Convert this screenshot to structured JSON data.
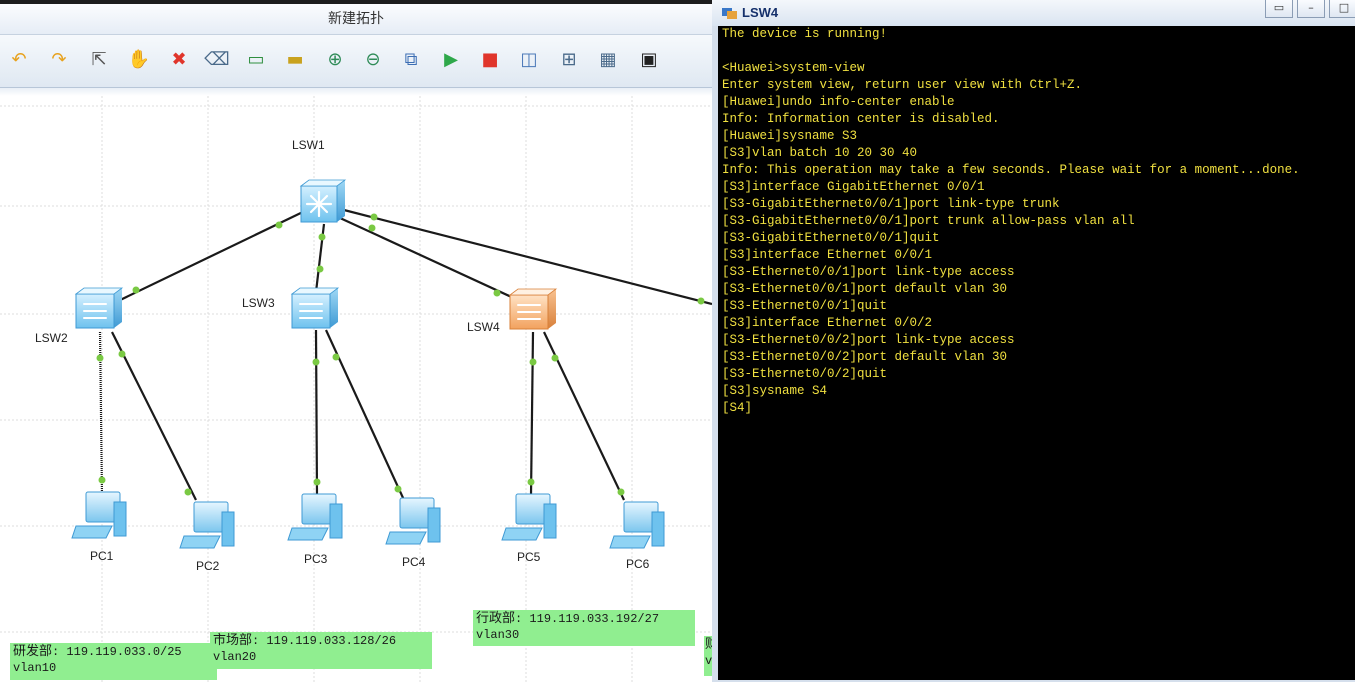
{
  "ensp": {
    "title": "新建拓扑",
    "toolbar": [
      {
        "name": "undo-icon",
        "glyph": "↶"
      },
      {
        "name": "redo-icon",
        "glyph": "↷"
      },
      {
        "name": "select-pointer-icon",
        "glyph": "⇱"
      },
      {
        "name": "pan-hand-icon",
        "glyph": "✋"
      },
      {
        "name": "delete-icon",
        "glyph": "✖"
      },
      {
        "name": "delete-link-icon",
        "glyph": "⌫"
      },
      {
        "name": "text-note-icon",
        "glyph": "▭"
      },
      {
        "name": "rectangle-icon",
        "glyph": "▬"
      },
      {
        "name": "zoom-in-icon",
        "glyph": "⊕"
      },
      {
        "name": "zoom-out-icon",
        "glyph": "⊖"
      },
      {
        "name": "fit-view-icon",
        "glyph": "⧉"
      },
      {
        "name": "start-device-icon",
        "glyph": "▶"
      },
      {
        "name": "stop-device-icon",
        "glyph": "■"
      },
      {
        "name": "capture-icon",
        "glyph": "◫"
      },
      {
        "name": "topology-icon",
        "glyph": "⊞"
      },
      {
        "name": "grid-icon",
        "glyph": "▦"
      },
      {
        "name": "console-icon",
        "glyph": "▣"
      }
    ],
    "devices": {
      "lsw1": "LSW1",
      "lsw2": "LSW2",
      "lsw3": "LSW3",
      "lsw4": "LSW4",
      "pc1": "PC1",
      "pc2": "PC2",
      "pc3": "PC3",
      "pc4": "PC4",
      "pc5": "PC5",
      "pc6": "PC6"
    },
    "notes": [
      {
        "dept": "研发部",
        "subnet": ": 119.119.033.0/25",
        "vlan": "vlan10"
      },
      {
        "dept": "市场部",
        "subnet": ": 119.119.033.128/26",
        "vlan": "vlan20"
      },
      {
        "dept": "行政部",
        "subnet": ": 119.119.033.192/27",
        "vlan": "vlan30"
      },
      {
        "dept": "财",
        "subnet": "",
        "vlan": "v"
      }
    ]
  },
  "console": {
    "title": "LSW4",
    "buttons": {
      "restore": "▭",
      "minimize": "–",
      "maximize": "□"
    },
    "lines": [
      "The device is running!",
      "",
      "<Huawei>system-view",
      "Enter system view, return user view with Ctrl+Z.",
      "[Huawei]undo info-center enable",
      "Info: Information center is disabled.",
      "[Huawei]sysname S3",
      "[S3]vlan batch 10 20 30 40",
      "Info: This operation may take a few seconds. Please wait for a moment...done.",
      "[S3]interface GigabitEthernet 0/0/1",
      "[S3-GigabitEthernet0/0/1]port link-type trunk",
      "[S3-GigabitEthernet0/0/1]port trunk allow-pass vlan all",
      "[S3-GigabitEthernet0/0/1]quit",
      "[S3]interface Ethernet 0/0/1",
      "[S3-Ethernet0/0/1]port link-type access",
      "[S3-Ethernet0/0/1]port default vlan 30",
      "[S3-Ethernet0/0/1]quit",
      "[S3]interface Ethernet 0/0/2",
      "[S3-Ethernet0/0/2]port link-type access",
      "[S3-Ethernet0/0/2]port default vlan 30",
      "[S3-Ethernet0/0/2]quit",
      "[S3]sysname S4",
      "[S4]"
    ]
  },
  "colors": {
    "terminal_bg": "#000000",
    "terminal_fg": "#f0e040",
    "note_bg": "#90ee90",
    "link_endpoint": "#7ac943",
    "switch_blue": "#8fd3f4",
    "switch_orange": "#f5b57a"
  }
}
